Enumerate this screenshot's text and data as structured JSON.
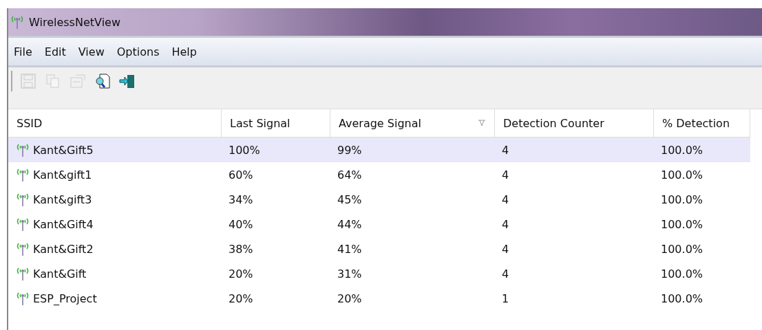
{
  "window": {
    "title": "WirelessNetView"
  },
  "menu": [
    "File",
    "Edit",
    "View",
    "Options",
    "Help"
  ],
  "toolbar": [
    {
      "kind": "save",
      "disabled": true
    },
    {
      "kind": "copy",
      "disabled": true
    },
    {
      "kind": "properties",
      "disabled": true
    },
    {
      "kind": "find",
      "disabled": false
    },
    {
      "kind": "exit",
      "disabled": false
    }
  ],
  "table": {
    "columns": [
      {
        "label": "SSID",
        "sorted": false
      },
      {
        "label": "Last Signal",
        "sorted": false
      },
      {
        "label": "Average Signal",
        "sorted": true
      },
      {
        "label": "Detection Counter",
        "sorted": false
      },
      {
        "label": "% Detection",
        "sorted": false
      }
    ],
    "rows": [
      {
        "selected": true,
        "cells": [
          "Kant&Gift5",
          "100%",
          "99%",
          "4",
          "100.0%"
        ]
      },
      {
        "selected": false,
        "cells": [
          "Kant&gift1",
          "60%",
          "64%",
          "4",
          "100.0%"
        ]
      },
      {
        "selected": false,
        "cells": [
          "Kant&gift3",
          "34%",
          "45%",
          "4",
          "100.0%"
        ]
      },
      {
        "selected": false,
        "cells": [
          "Kant&Gift4",
          "40%",
          "44%",
          "4",
          "100.0%"
        ]
      },
      {
        "selected": false,
        "cells": [
          "Kant&Gift2",
          "38%",
          "41%",
          "4",
          "100.0%"
        ]
      },
      {
        "selected": false,
        "cells": [
          "Kant&Gift",
          "20%",
          "31%",
          "4",
          "100.0%"
        ]
      },
      {
        "selected": false,
        "cells": [
          "ESP_Project",
          "20%",
          "20%",
          "1",
          "100.0%"
        ]
      }
    ]
  }
}
